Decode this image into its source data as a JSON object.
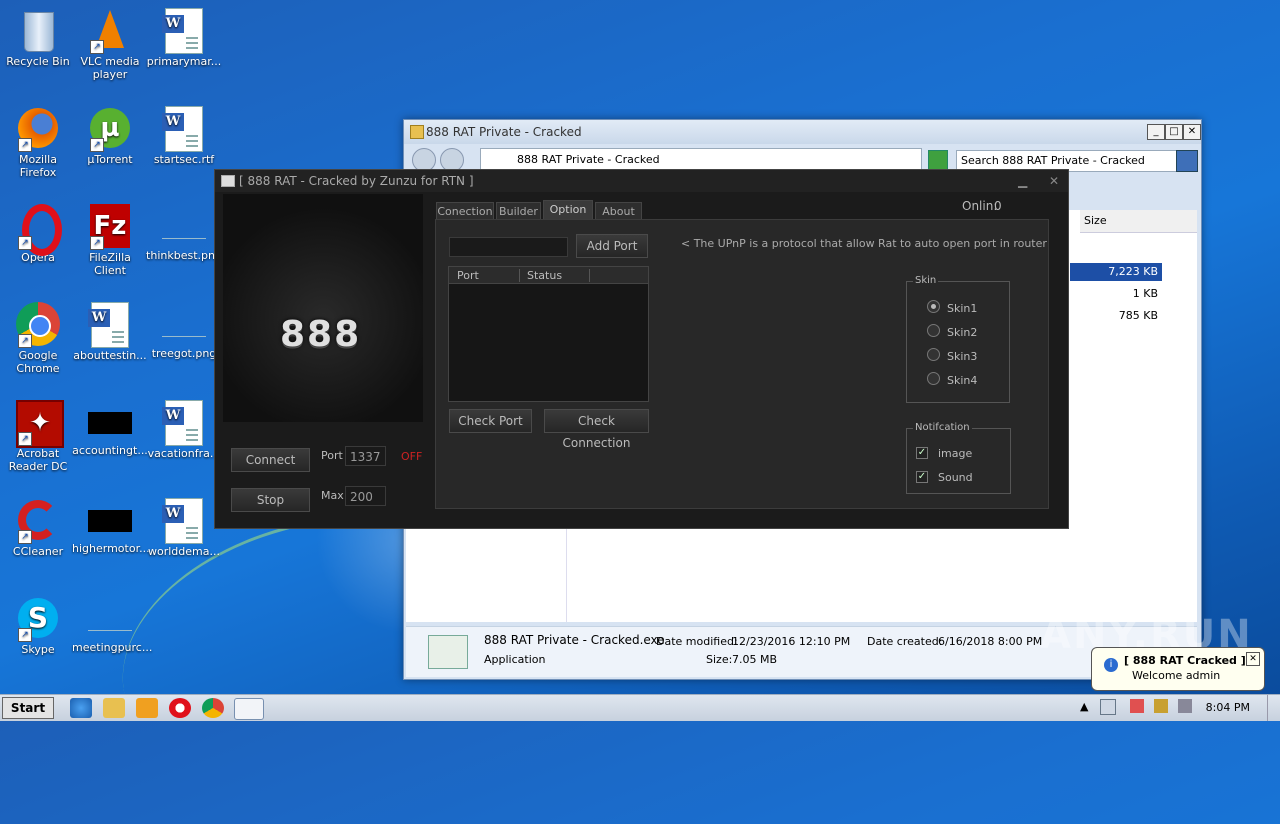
{
  "desktop": {
    "icons": [
      {
        "label": "Recycle Bin"
      },
      {
        "label": "VLC media player"
      },
      {
        "label": "primarymar..."
      },
      {
        "label": "Mozilla Firefox"
      },
      {
        "label": "µTorrent"
      },
      {
        "label": "startsec.rtf"
      },
      {
        "label": "Opera"
      },
      {
        "label": "FileZilla Client"
      },
      {
        "label": "thinkbest.png"
      },
      {
        "label": "Google Chrome"
      },
      {
        "label": "abouttestin..."
      },
      {
        "label": "treegot.png"
      },
      {
        "label": "Acrobat Reader DC"
      },
      {
        "label": "accountingt..."
      },
      {
        "label": "vacationfra..."
      },
      {
        "label": "CCleaner"
      },
      {
        "label": "highermotor..."
      },
      {
        "label": "worlddema..."
      },
      {
        "label": "Skype"
      },
      {
        "label": "meetingpurc..."
      }
    ]
  },
  "explorer": {
    "title": "888 RAT Private - Cracked",
    "address": "888 RAT Private - Cracked",
    "search_placeholder": "Search 888 RAT Private - Cracked",
    "column_size": "Size",
    "sizes": [
      "7,223 KB",
      "1 KB",
      "785 KB"
    ],
    "details": {
      "filename": "888 RAT Private - Cracked.exe",
      "type": "Application",
      "date_modified_label": "Date modified:",
      "date_modified": "12/23/2016 12:10 PM",
      "date_created_label": "Date created:",
      "date_created": "6/16/2018 8:00 PM",
      "size_label": "Size:",
      "size": "7.05 MB"
    }
  },
  "rat": {
    "title": "[ 888 RAT - Cracked by Zunzu for RTN ]",
    "logo": "888",
    "online_label": "Onlin:",
    "online_count": "0",
    "tabs": [
      "Conection",
      "Builder",
      "Option",
      "About"
    ],
    "connect": "Connect",
    "stop": "Stop",
    "port_label": "Port",
    "port_value": "1337",
    "max_label": "Max",
    "max_value": "200",
    "status": "OFF",
    "add_port": "Add Port",
    "upnp_note": "< The UPnP is a protocol that allow Rat to auto open port in router",
    "table_headers": [
      "Port",
      "Status"
    ],
    "check_port": "Check Port",
    "check_connection": "Check Connection",
    "skin_caption": "Skin",
    "skins": [
      "Skin1",
      "Skin2",
      "Skin3",
      "Skin4"
    ],
    "notification_caption": "Notifcation",
    "notifications": [
      "image",
      "Sound"
    ]
  },
  "taskbar": {
    "start": "Start",
    "clock": "8:04 PM"
  },
  "balloon": {
    "title": "[ 888 RAT Cracked ]",
    "text": "Welcome admin"
  },
  "watermark": "ANY.RUN",
  "colors": {
    "off_status": "#cc2222",
    "desktop_blue": "#1a6fd0"
  }
}
